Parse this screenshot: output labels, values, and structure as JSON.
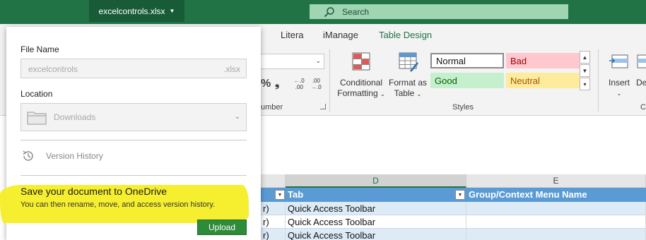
{
  "titlebar": {
    "filename": "excelcontrols.xlsx",
    "search_label": "Search"
  },
  "ribbon_tabs": [
    {
      "label": "Litera"
    },
    {
      "label": "iManage"
    },
    {
      "label": "Table Design",
      "active": true
    }
  ],
  "ribbon": {
    "number_group_label": "umber",
    "percent_symbol": "%",
    "comma_symbol": "❟",
    "increase_decimal": [
      ".0",
      ".00"
    ],
    "decrease_decimal": [
      ".00",
      ".0"
    ],
    "conditional_formatting": [
      "Conditional",
      "Formatting"
    ],
    "format_as_table": [
      "Format as",
      "Table"
    ],
    "styles_group_label": "Styles",
    "cell_styles": [
      {
        "label": "Normal",
        "bg": "#ffffff",
        "fg": "#111111"
      },
      {
        "label": "Bad",
        "bg": "#ffc7ce",
        "fg": "#9c0006"
      },
      {
        "label": "Good",
        "bg": "#c6efce",
        "fg": "#006100"
      },
      {
        "label": "Neutral",
        "bg": "#ffeb9c",
        "fg": "#9c5700"
      }
    ],
    "insert_label": "Insert",
    "delete_label": "De",
    "cells_group_label": "C"
  },
  "sheet": {
    "columns": [
      {
        "label": ""
      },
      {
        "label": "D"
      },
      {
        "label": "E"
      }
    ],
    "table_header": [
      "",
      "Tab",
      "Group/Context Menu Name"
    ],
    "rows": [
      [
        "r)",
        "Quick Access Toolbar",
        ""
      ],
      [
        "r)",
        "Quick Access Toolbar",
        ""
      ],
      [
        "r)",
        "Quick Access Toolbar",
        ""
      ]
    ]
  },
  "panel": {
    "file_name_label": "File Name",
    "file_name_value": "excelcontrols",
    "file_ext": ".xlsx",
    "location_label": "Location",
    "location_value": "Downloads",
    "version_history_label": "Version History",
    "promo_title": "Save your document to OneDrive",
    "promo_subtitle": "You can then rename, move, and access version history.",
    "upload_label": "Upload"
  },
  "colors": {
    "excel_green": "#217346",
    "highlighter": "#f6ee27",
    "table_header": "#5b9bd5",
    "upload_button": "#2e8b3a"
  }
}
